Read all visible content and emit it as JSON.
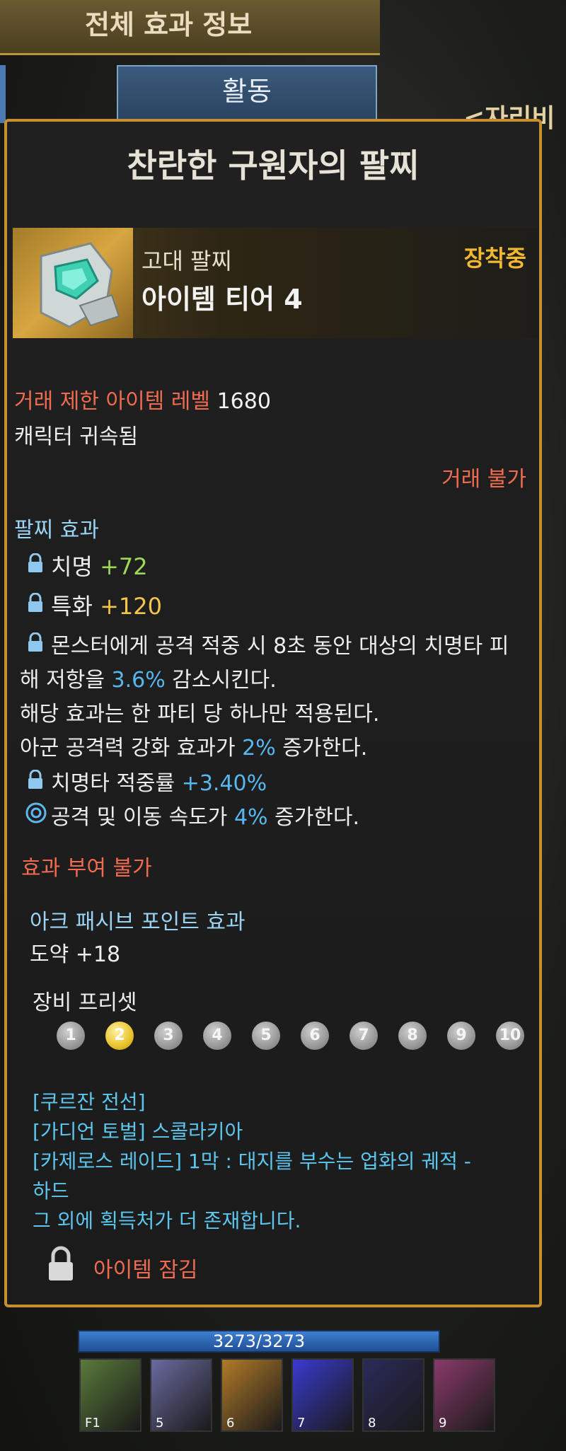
{
  "background": {
    "top_tab_title": "전체 효과 정보",
    "sub_tab_label": "활동",
    "right_link_text": "<자리비우"
  },
  "item": {
    "name": "찬란한 구원자의 팔찌",
    "grade": "고대 팔찌",
    "tier": "아이템 티어 4",
    "equipped_label": "장착중",
    "level_label": "거래 제한 아이템 레벨",
    "level_value": "1680",
    "bound": "캐릭터 귀속됨",
    "trade": "거래 불가"
  },
  "effects": {
    "section_title": "팔찌 효과",
    "crit_label": "치명",
    "crit_value": "+72",
    "spec_label": "특화",
    "spec_value": "+120",
    "special_1a": "몬스터에게 공격 적중 시 8초 동안 대상의 치명타 피",
    "special_1b_pre": "해 저항을",
    "special_1b_val": "3.6%",
    "special_1b_post": "감소시킨다.",
    "special_1c": "해당 효과는 한 파티 당 하나만 적용된다.",
    "special_1d_pre": "아군 공격력 강화 효과가",
    "special_1d_val": "2%",
    "special_1d_post": "증가한다.",
    "crit_rate_label": "치명타 적중률",
    "crit_rate_value": "+3.40%",
    "speed_pre": "공격 및 이동 속도가",
    "speed_val": "4%",
    "speed_post": "증가한다."
  },
  "no_grant": "효과 부여 불가",
  "ark": {
    "title": "아크 패시브 포인트 효과",
    "value": "도약 +18"
  },
  "preset": {
    "title": "장비 프리셋",
    "numbers": [
      "1",
      "2",
      "3",
      "4",
      "5",
      "6",
      "7",
      "8",
      "9",
      "10"
    ],
    "active_index": 1
  },
  "sources": {
    "line1": "[쿠르잔 전선]",
    "line2": "[가디언 토벌] 스콜라키아",
    "line3": "[카제로스 레이드] 1막 : 대지를 부수는 업화의 궤적 -",
    "line4": "하드",
    "line5": "그 외에 획득처가 더 존재합니다."
  },
  "lock_label": "아이템 잠김",
  "hud": {
    "hp_text": "3273/3273",
    "slot_keys": [
      "F1",
      "5",
      "6",
      "7",
      "8",
      "9"
    ],
    "slot_colors": [
      "#5a7a3a",
      "#6a6aa0",
      "#b27a2a",
      "#3a3ad0",
      "#2a2a5a",
      "#8a3a6a"
    ]
  },
  "colors": {
    "accent_gold": "#c8902f",
    "stat_green": "#9fd855",
    "stat_yellow": "#f2c64c",
    "value_blue": "#58b7ef",
    "warning_red": "#f06b4f"
  }
}
